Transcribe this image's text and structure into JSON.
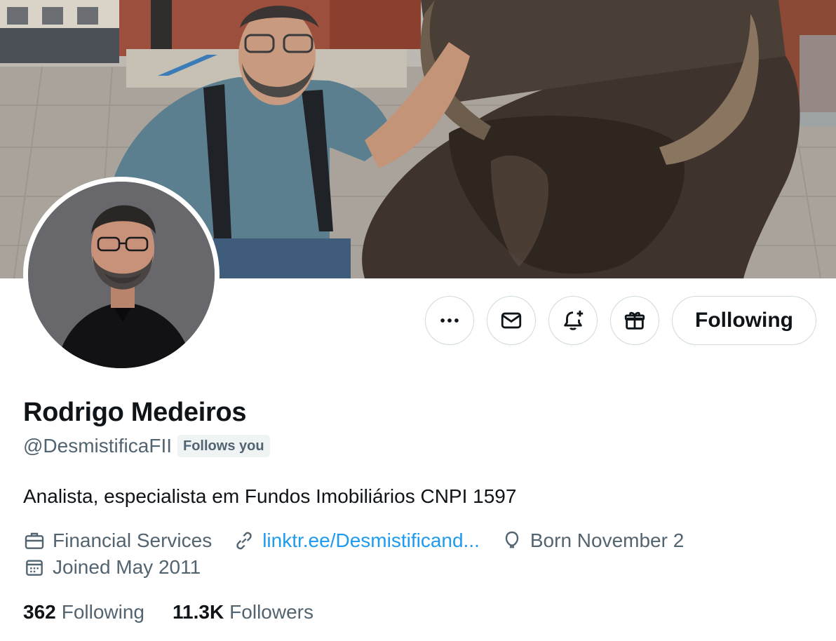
{
  "profile": {
    "name": "Rodrigo Medeiros",
    "handle": "@DesmistificaFII",
    "follows_you_badge": "Follows you",
    "bio": "Analista, especialista em Fundos Imobiliários CNPI 1597",
    "category": "Financial Services",
    "link": "linktr.ee/Desmistificand...",
    "birthday": "Born November 2",
    "joined": "Joined May 2011",
    "following_count": "362",
    "following_label": "Following",
    "followers_count": "11.3K",
    "followers_label": "Followers"
  },
  "actions": {
    "more_icon": "more-horizontal-icon",
    "message_icon": "envelope-icon",
    "notify_icon": "bell-plus-icon",
    "subscribe_icon": "gift-icon",
    "following_button": "Following"
  },
  "icons": {
    "category": "briefcase-icon",
    "link": "link-icon",
    "birthday": "balloon-icon",
    "joined": "calendar-icon"
  },
  "colors": {
    "text_primary": "#0f1419",
    "text_secondary": "#536471",
    "link": "#1d9bf0",
    "border": "#cfd9de"
  }
}
